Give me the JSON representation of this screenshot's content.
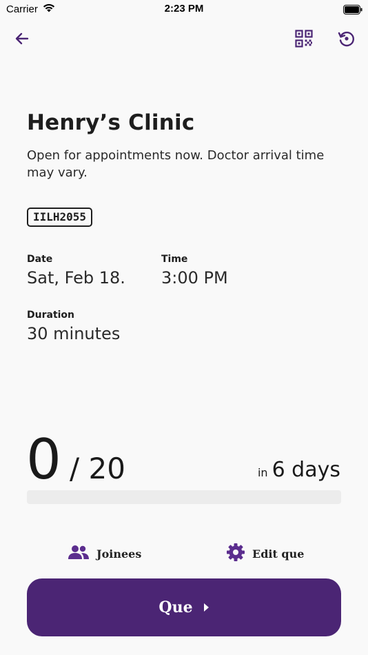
{
  "status_bar": {
    "carrier": "Carrier",
    "time": "2:23 PM"
  },
  "nav": {
    "back_icon": "arrow-left-icon",
    "qr_icon": "qr-code-icon",
    "history_icon": "history-icon"
  },
  "clinic": {
    "name": "Henry’s Clinic",
    "description": "Open for appointments now. Doctor arrival time may vary.",
    "code": "IILH2055"
  },
  "details": {
    "date_label": "Date",
    "date_value": "Sat, Feb 18.",
    "time_label": "Time",
    "time_value": "3:00 PM",
    "duration_label": "Duration",
    "duration_value": "30 minutes"
  },
  "queue": {
    "current": "0",
    "total_text": "/ 20",
    "eta_prefix": "in",
    "eta_value": "6 days",
    "progress": 0
  },
  "actions": {
    "joinees_label": "Joinees",
    "edit_label": "Edit que",
    "primary_label": "Que"
  },
  "colors": {
    "accent": "#4b2574",
    "icon_purple": "#5b2d8e",
    "background": "#f9f9f9",
    "progress_track": "#ececec"
  }
}
